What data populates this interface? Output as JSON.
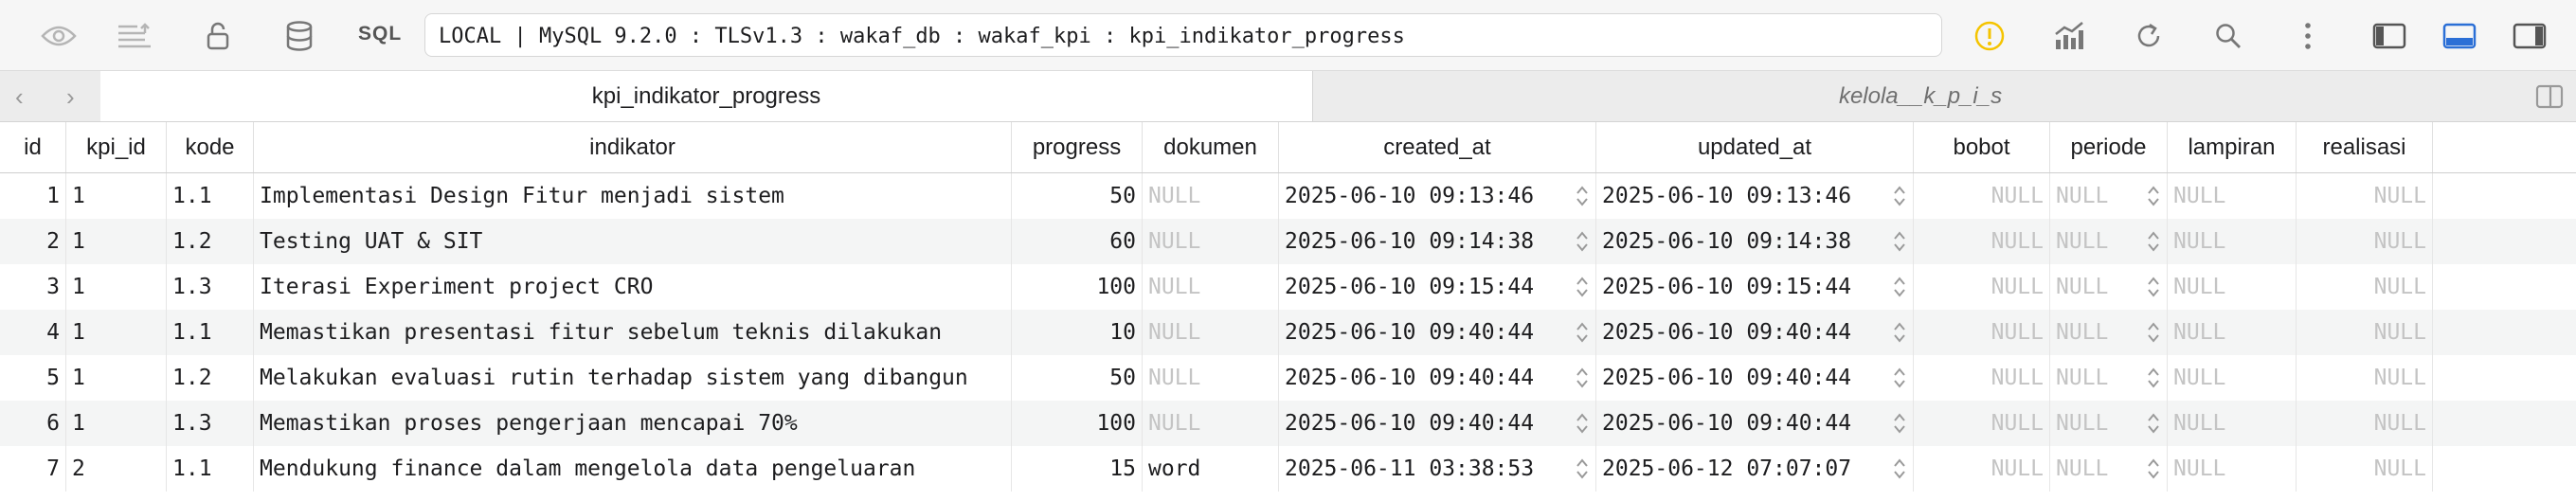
{
  "toolbar": {
    "sql_label": "SQL",
    "connection": "LOCAL | MySQL 9.2.0 : TLSv1.3 : wakaf_db : wakaf_kpi : kpi_indikator_progress",
    "icons": [
      "eye-icon",
      "sort-lines-icon",
      "lock-icon",
      "database-icon",
      "warning-icon",
      "chart-icon",
      "refresh-icon",
      "search-icon",
      "more-icon",
      "left-panel-icon",
      "bottom-panel-icon",
      "right-panel-icon"
    ],
    "warning_color": "#f5c400",
    "accent_color": "#2b6fd6"
  },
  "tabs": [
    {
      "label": "kpi_indikator_progress",
      "active": true
    },
    {
      "label": "kelola__k_p_i_s",
      "active": false
    }
  ],
  "table": {
    "columns": [
      "id",
      "kpi_id",
      "kode",
      "indikator",
      "progress",
      "dokumen",
      "created_at",
      "updated_at",
      "bobot",
      "periode",
      "lampiran",
      "realisasi"
    ],
    "rows": [
      {
        "id": "1",
        "kpi_id": "1",
        "kode": "1.1",
        "indikator": "Implementasi Design Fitur menjadi sistem",
        "progress": "50",
        "dokumen": "NULL",
        "created_at": "2025-06-10 09:13:46",
        "updated_at": "2025-06-10 09:13:46",
        "bobot": "NULL",
        "periode": "NULL",
        "lampiran": "NULL",
        "realisasi": "NULL"
      },
      {
        "id": "2",
        "kpi_id": "1",
        "kode": "1.2",
        "indikator": "Testing UAT & SIT",
        "progress": "60",
        "dokumen": "NULL",
        "created_at": "2025-06-10 09:14:38",
        "updated_at": "2025-06-10 09:14:38",
        "bobot": "NULL",
        "periode": "NULL",
        "lampiran": "NULL",
        "realisasi": "NULL"
      },
      {
        "id": "3",
        "kpi_id": "1",
        "kode": "1.3",
        "indikator": "Iterasi Experiment project CRO",
        "progress": "100",
        "dokumen": "NULL",
        "created_at": "2025-06-10 09:15:44",
        "updated_at": "2025-06-10 09:15:44",
        "bobot": "NULL",
        "periode": "NULL",
        "lampiran": "NULL",
        "realisasi": "NULL"
      },
      {
        "id": "4",
        "kpi_id": "1",
        "kode": "1.1",
        "indikator": "Memastikan presentasi fitur sebelum teknis dilakukan",
        "progress": "10",
        "dokumen": "NULL",
        "created_at": "2025-06-10 09:40:44",
        "updated_at": "2025-06-10 09:40:44",
        "bobot": "NULL",
        "periode": "NULL",
        "lampiran": "NULL",
        "realisasi": "NULL"
      },
      {
        "id": "5",
        "kpi_id": "1",
        "kode": "1.2",
        "indikator": "Melakukan evaluasi rutin terhadap sistem yang dibangun",
        "progress": "50",
        "dokumen": "NULL",
        "created_at": "2025-06-10 09:40:44",
        "updated_at": "2025-06-10 09:40:44",
        "bobot": "NULL",
        "periode": "NULL",
        "lampiran": "NULL",
        "realisasi": "NULL"
      },
      {
        "id": "6",
        "kpi_id": "1",
        "kode": "1.3",
        "indikator": "Memastikan proses pengerjaan mencapai 70%",
        "progress": "100",
        "dokumen": "NULL",
        "created_at": "2025-06-10 09:40:44",
        "updated_at": "2025-06-10 09:40:44",
        "bobot": "NULL",
        "periode": "NULL",
        "lampiran": "NULL",
        "realisasi": "NULL"
      },
      {
        "id": "7",
        "kpi_id": "2",
        "kode": "1.1",
        "indikator": "Mendukung finance dalam mengelola data pengeluaran",
        "progress": "15",
        "dokumen": "word",
        "created_at": "2025-06-11 03:38:53",
        "updated_at": "2025-06-12 07:07:07",
        "bobot": "NULL",
        "periode": "NULL",
        "lampiran": "NULL",
        "realisasi": "NULL"
      }
    ]
  }
}
